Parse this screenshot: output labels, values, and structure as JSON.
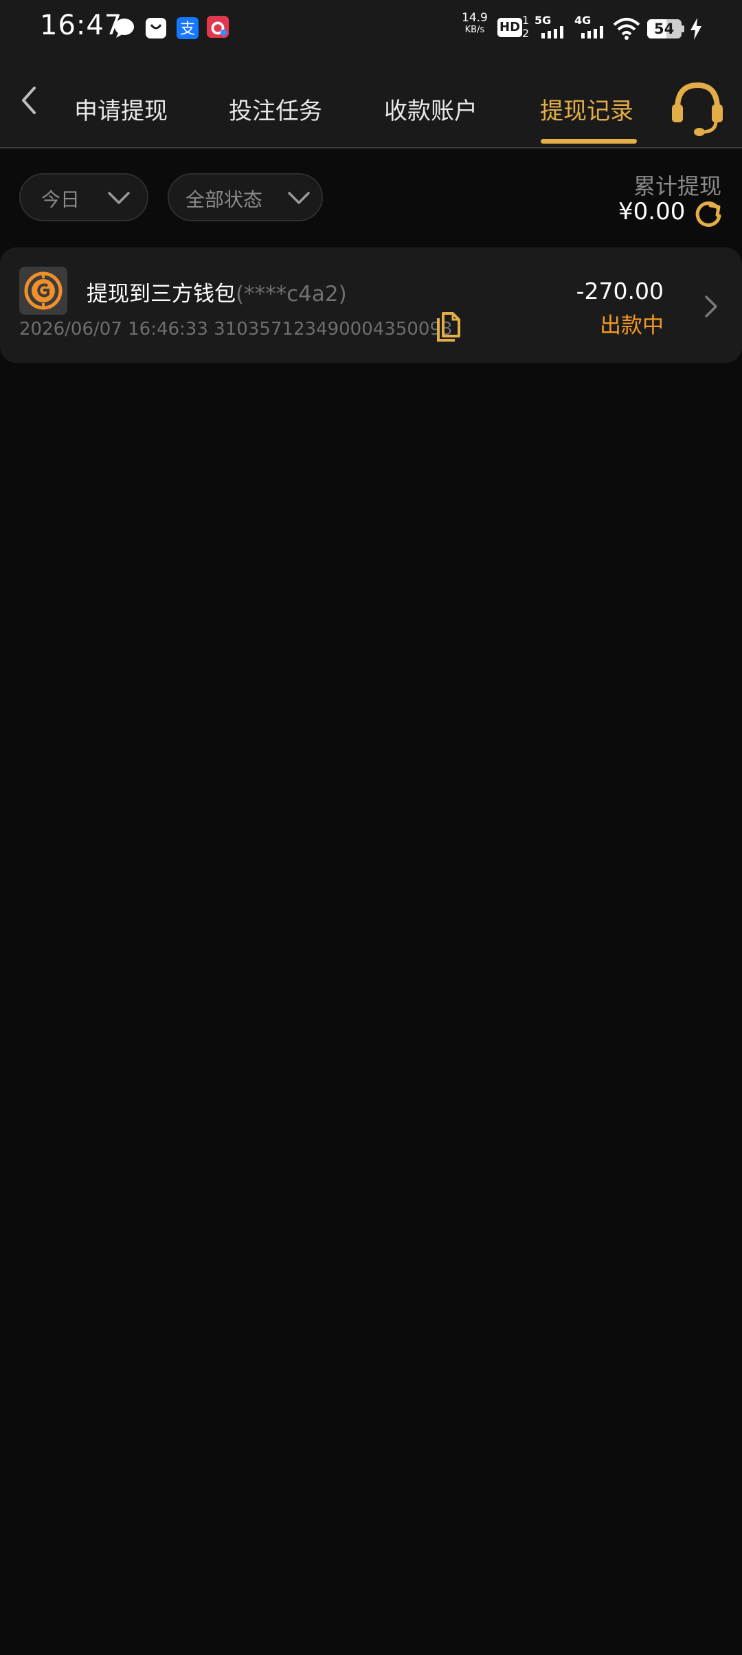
{
  "status_bar": {
    "time": "16:47",
    "net_speed_value": "14.9",
    "net_speed_unit": "KB/s",
    "hd_badge": "HD",
    "hd_sub_top": "1",
    "hd_sub_bottom": "2",
    "signal_5g": "5G",
    "signal_4g": "4G",
    "battery": "54",
    "icons": [
      "message-icon",
      "bag-icon",
      "alipay-icon",
      "app-icon",
      "wifi-icon",
      "battery-icon",
      "charging-icon"
    ]
  },
  "nav": {
    "tabs": [
      {
        "label": "申请提现",
        "active": false
      },
      {
        "label": "投注任务",
        "active": false
      },
      {
        "label": "收款账户",
        "active": false
      },
      {
        "label": "提现记录",
        "active": true
      }
    ],
    "back_icon": "chevron-left-icon",
    "support_icon": "headset-icon"
  },
  "filters": {
    "date": "今日",
    "status": "全部状态"
  },
  "summary": {
    "label": "累计提现",
    "value": "¥0.00"
  },
  "records": [
    {
      "title": "提现到三方钱包",
      "account": "(****c4a2)",
      "datetime": "2026/06/07 16:46:33",
      "order_id": "310357123490004350093",
      "amount": "-270.00",
      "status": "出款中"
    }
  ],
  "colors": {
    "accent": "#e3ad48",
    "status_pending": "#f59a23",
    "background": "#0b0b0b",
    "card": "#1b1b1b"
  }
}
